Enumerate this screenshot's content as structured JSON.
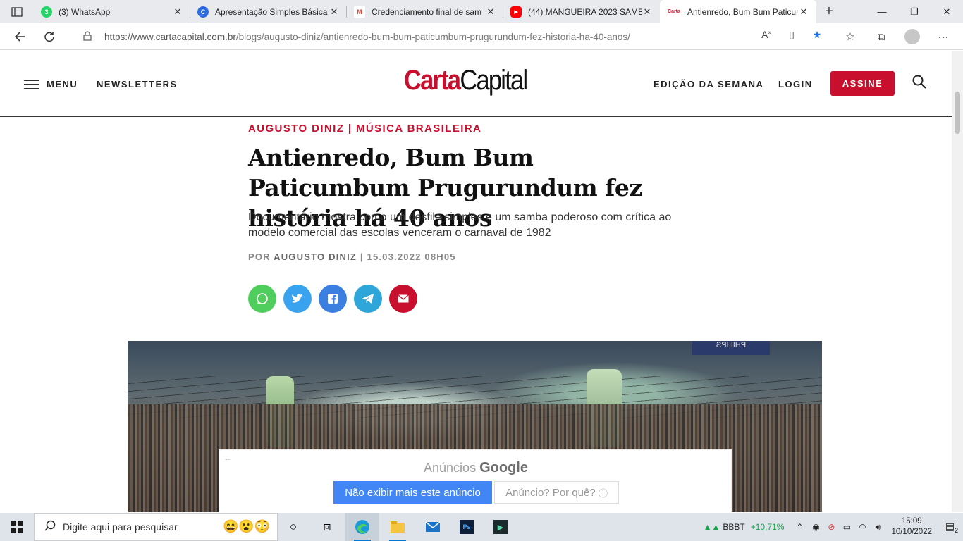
{
  "browser": {
    "tabs": [
      {
        "title": "(3) WhatsApp",
        "favicon_color": "#25d366",
        "badge": "3"
      },
      {
        "title": "Apresentação Simples Básica",
        "favicon_color": "#2d6be4",
        "badge": "C"
      },
      {
        "title": "Credenciamento final de sam",
        "favicon_color": "#ea4335",
        "badge": "M"
      },
      {
        "title": "(44) MANGUEIRA 2023 SAMB",
        "favicon_color": "#ff0000",
        "badge": "▶"
      },
      {
        "title": "Antienredo, Bum Bum Paticum",
        "favicon_color": "#c8102e",
        "badge": "Carta",
        "active": true
      }
    ],
    "url_host": "https://www.cartacapital.com.br",
    "url_path": "/blogs/augusto-diniz/antienredo-bum-bum-paticumbum-prugurundum-fez-historia-ha-40-anos/"
  },
  "site": {
    "menu_label": "MENU",
    "newsletters_label": "NEWSLETTERS",
    "logo_red": "Carta",
    "logo_black": "Capital",
    "edicao_label": "EDIÇÃO DA SEMANA",
    "login_label": "LOGIN",
    "assine_label": "ASSINE"
  },
  "article": {
    "kicker": "AUGUSTO DINIZ | MÚSICA BRASILEIRA",
    "headline": "Antienredo, Bum Bum Paticumbum Prugurundum fez história há 40 anos",
    "subtitle": "Documentário mostra como um desfile simples e um samba poderoso com crítica ao modelo comercial das escolas venceram o carnaval de 1982",
    "byline_prefix": "POR",
    "byline_author": "AUGUSTO DINIZ",
    "byline_sep": "|",
    "byline_date": "15.03.2022 08H05",
    "share": [
      {
        "name": "whatsapp",
        "color": "#4fce5d"
      },
      {
        "name": "twitter",
        "color": "#3aa3f0"
      },
      {
        "name": "facebook",
        "color": "#3b7fe0"
      },
      {
        "name": "telegram",
        "color": "#2ea6da"
      },
      {
        "name": "email",
        "color": "#c8102e"
      }
    ],
    "hero_sign": "PHILIPS"
  },
  "ad": {
    "label_prefix": "Anúncios",
    "label_brand": "Google",
    "stop_button": "Não exibir mais este anúncio",
    "why_button": "Anúncio? Por quê?",
    "why_icon": "ⓘ"
  },
  "taskbar": {
    "search_placeholder": "Digite aqui para pesquisar",
    "stock_symbol": "BBBT",
    "stock_change": "+10,71%",
    "time": "15:09",
    "date": "10/10/2022",
    "notif_count": "2"
  }
}
